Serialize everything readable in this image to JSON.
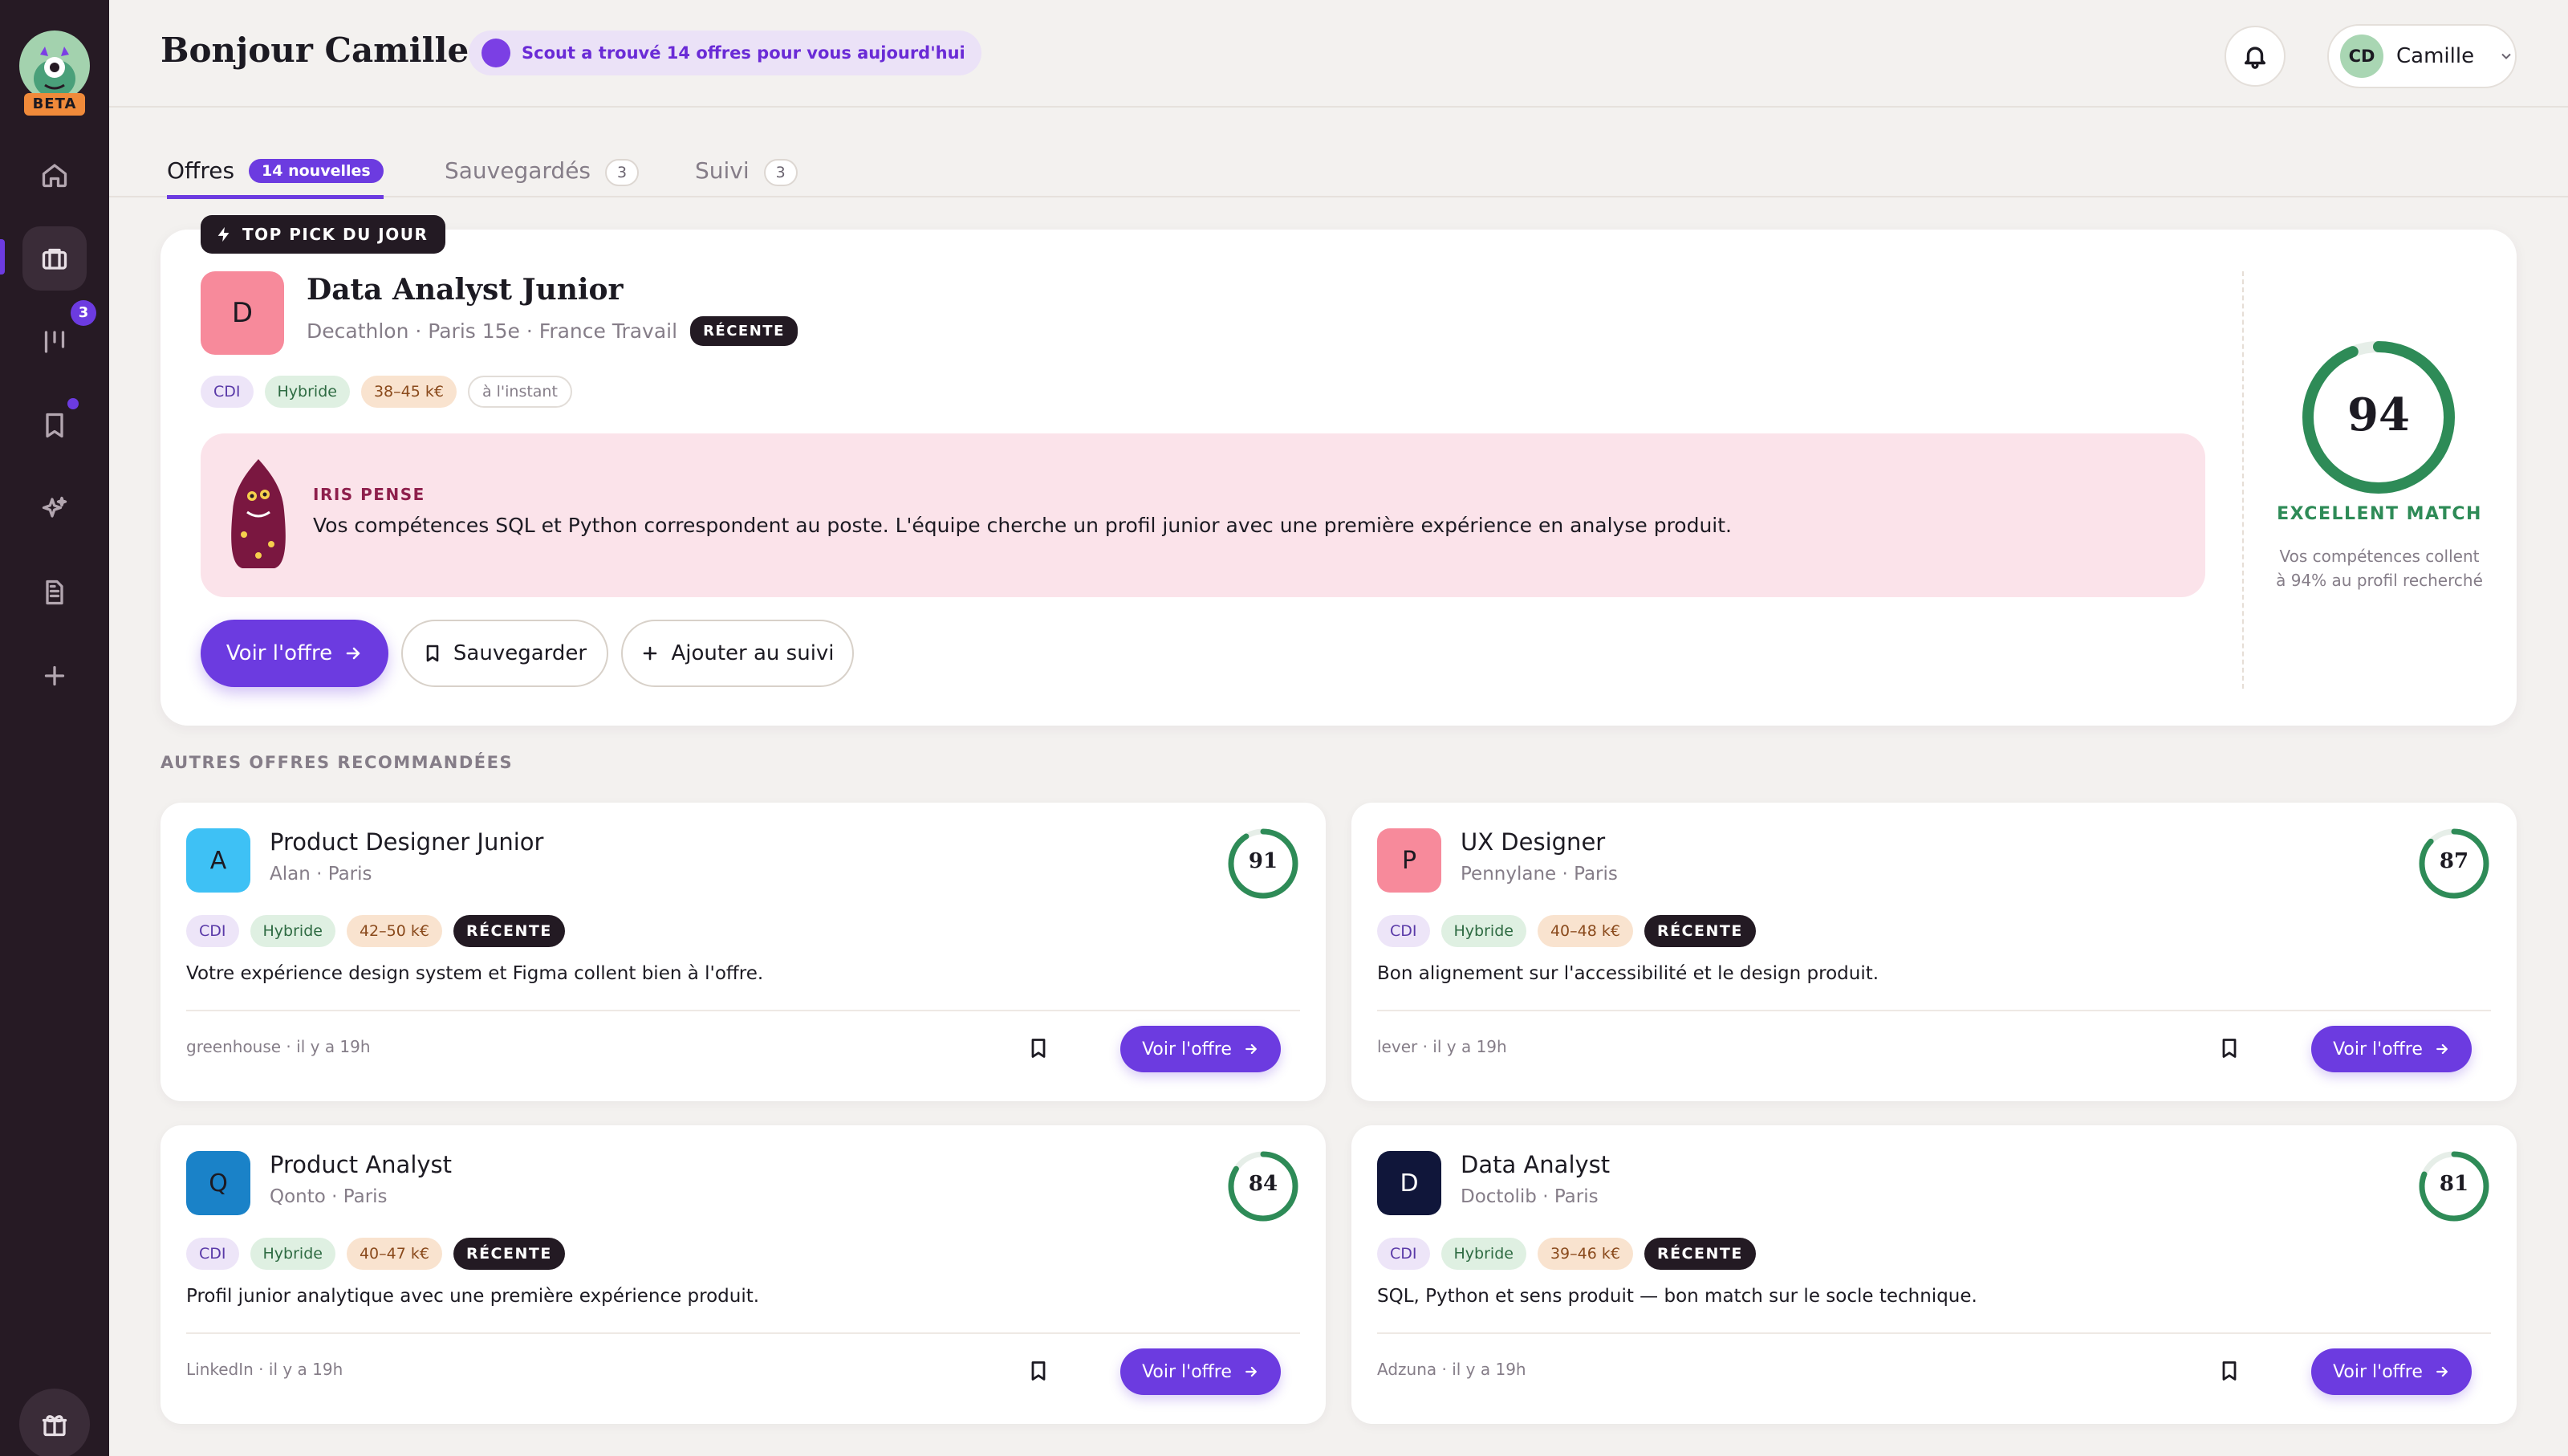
{
  "sidebar": {
    "beta_label": "BETA",
    "tracking_badge": "3",
    "items": [
      {
        "name": "home",
        "icon": "home-icon"
      },
      {
        "name": "offers",
        "icon": "briefcase-icon",
        "active": true
      },
      {
        "name": "tracking",
        "icon": "kanban-icon"
      },
      {
        "name": "saved",
        "icon": "bookmark-icon"
      },
      {
        "name": "ai",
        "icon": "sparkles-icon"
      },
      {
        "name": "documents",
        "icon": "document-icon"
      },
      {
        "name": "add",
        "icon": "plus-icon"
      },
      {
        "name": "gift",
        "icon": "gift-icon"
      }
    ]
  },
  "header": {
    "greeting": "Bonjour Camille",
    "scout_text": "Scout a trouvé 14 offres pour vous aujourd'hui",
    "user_initials": "CD",
    "user_name": "Camille"
  },
  "tabs": [
    {
      "label": "Offres",
      "badge": "14 nouvelles"
    },
    {
      "label": "Sauvegardés",
      "count": "3"
    },
    {
      "label": "Suivi",
      "count": "3"
    }
  ],
  "hero": {
    "top_pick_label": "TOP PICK DU JOUR",
    "logo_letter": "D",
    "job_title": "Data Analyst Junior",
    "meta": "Decathlon · Paris 15e · France Travail",
    "recent_badge": "RÉCENTE",
    "tags": {
      "contract": "CDI",
      "mode": "Hybride",
      "salary": "38–45 k€",
      "time": "à l'instant"
    },
    "iris_label": "IRIS PENSE",
    "iris_text": "Vos compétences SQL et Python correspondent au poste. L'équipe cherche un profil junior avec une première expérience en analyse produit.",
    "btn_view": "Voir l'offre",
    "btn_save": "Sauvegarder",
    "btn_track": "Ajouter au suivi",
    "score": "94",
    "score_fraction": 0.94,
    "match_label": "EXCELLENT MATCH",
    "match_desc": "Vos compétences collent à 94% au profil recherché"
  },
  "section_title": "AUTRES OFFRES RECOMMANDÉES",
  "cards": [
    {
      "letter": "A",
      "logo_color": "#3ec1f5",
      "title": "Product Designer Junior",
      "meta": "Alan · Paris",
      "contract": "CDI",
      "mode": "Hybride",
      "salary": "42–50 k€",
      "recent": "RÉCENTE",
      "desc": "Votre expérience design system et Figma collent bien à l'offre.",
      "source": "greenhouse · il y a 19h",
      "score": "91",
      "score_fraction": 0.91,
      "btn": "Voir l'offre"
    },
    {
      "letter": "P",
      "logo_color": "#f78a9b",
      "title": "UX Designer",
      "meta": "Pennylane · Paris",
      "contract": "CDI",
      "mode": "Hybride",
      "salary": "40–48 k€",
      "recent": "RÉCENTE",
      "desc": "Bon alignement sur l'accessibilité et le design produit.",
      "source": "lever · il y a 19h",
      "score": "87",
      "score_fraction": 0.87,
      "btn": "Voir l'offre"
    },
    {
      "letter": "Q",
      "logo_color": "#1a82c8",
      "title": "Product Analyst",
      "meta": "Qonto · Paris",
      "contract": "CDI",
      "mode": "Hybride",
      "salary": "40–47 k€",
      "recent": "RÉCENTE",
      "desc": "Profil junior analytique avec une première expérience produit.",
      "source": "LinkedIn · il y a 19h",
      "score": "84",
      "score_fraction": 0.84,
      "btn": "Voir l'offre"
    },
    {
      "letter": "D",
      "logo_color": "#10163a",
      "title": "Data Analyst",
      "meta": "Doctolib · Paris",
      "contract": "CDI",
      "mode": "Hybride",
      "salary": "39–46 k€",
      "recent": "RÉCENTE",
      "desc": "SQL, Python et sens produit — bon match sur le socle technique.",
      "source": "Adzuna · il y a 19h",
      "score": "81",
      "score_fraction": 0.81,
      "btn": "Voir l'offre"
    }
  ],
  "colors": {
    "accent": "#6c3be0",
    "score_green": "#2e8b57",
    "sidebar_bg": "#261a24",
    "iris_bg": "#fbe3ea"
  }
}
